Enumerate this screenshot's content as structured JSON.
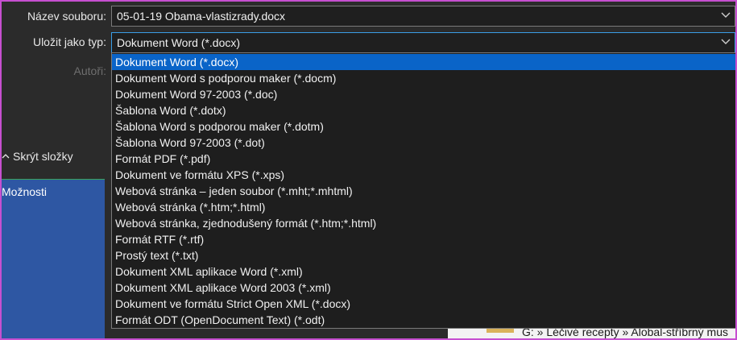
{
  "form": {
    "file_name_label": "Název souboru:",
    "file_name_value": "05-01-19 Obama-vlastizrady.docx",
    "save_type_label": "Uložit jako typ:",
    "save_type_value": "Dokument Word (*.docx)",
    "authors_label": "Autoři:"
  },
  "sidebar": {
    "hide_folders_label": "Skrýt složky",
    "options_label": "Možnosti"
  },
  "background": {
    "path_text": "G: » Léčivé recepty » Alobal-stříbrný mus"
  },
  "file_types": [
    "Dokument Word (*.docx)",
    "Dokument Word s podporou maker (*.docm)",
    "Dokument Word 97-2003 (*.doc)",
    "Šablona Word (*.dotx)",
    "Šablona Word s podporou maker (*.dotm)",
    "Šablona Word 97-2003 (*.dot)",
    "Formát PDF (*.pdf)",
    "Dokument ve formátu XPS (*.xps)",
    "Webová stránka – jeden soubor (*.mht;*.mhtml)",
    "Webová stránka (*.htm;*.html)",
    "Webová stránka, zjednodušený formát (*.htm;*.html)",
    "Formát RTF (*.rtf)",
    "Prostý text (*.txt)",
    "Dokument XML aplikace Word (*.xml)",
    "Dokument XML aplikace Word 2003 (*.xml)",
    "Dokument ve formátu Strict Open XML (*.docx)",
    "Formát ODT (OpenDocument Text) (*.odt)"
  ],
  "selected_index": 0,
  "colors": {
    "selection": "#0a64c8",
    "sidebar": "#2e57a3",
    "dialog_bg": "#2b2b2b"
  }
}
